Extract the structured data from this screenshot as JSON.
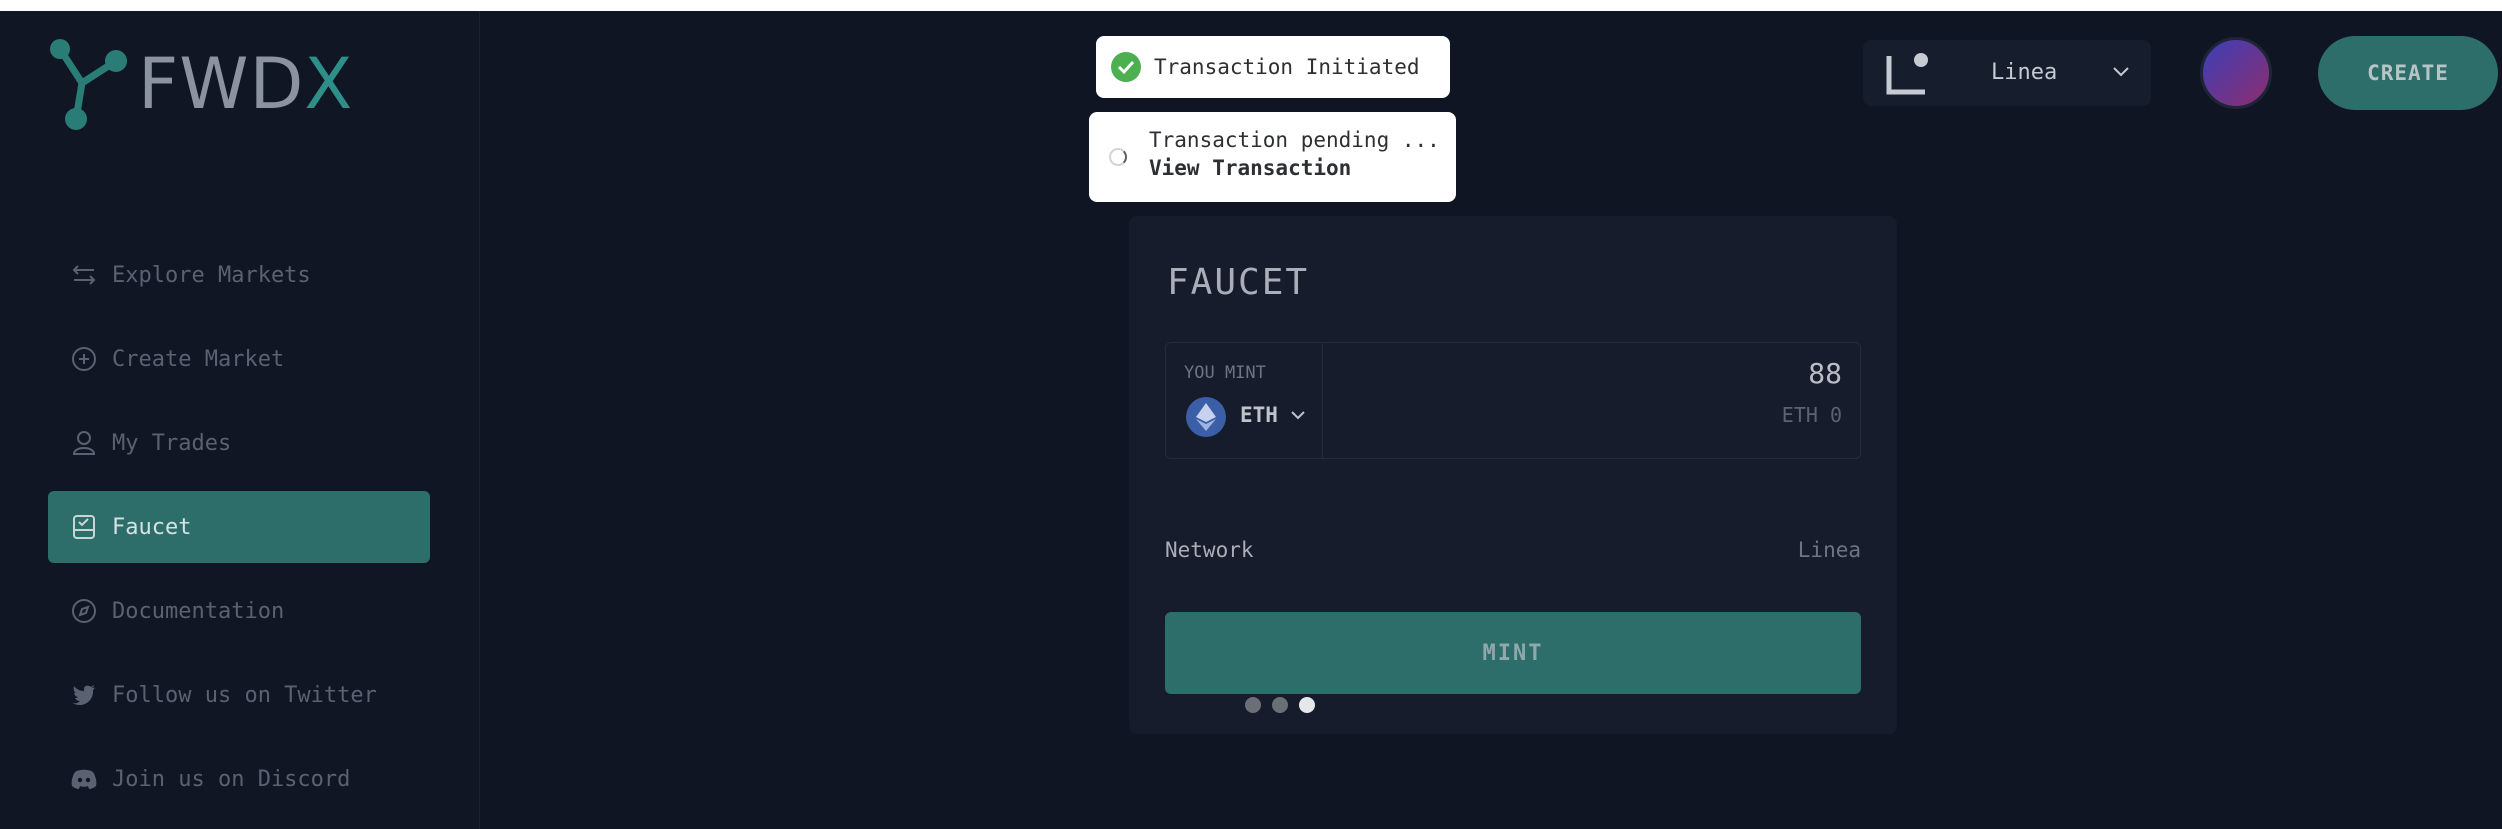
{
  "brand": {
    "name_main": "FWD",
    "name_accent": "X"
  },
  "sidebar": {
    "items": [
      {
        "label": "Explore Markets",
        "icon": "arrows-swap-icon",
        "active": false
      },
      {
        "label": "Create Market",
        "icon": "plus-circle-icon",
        "active": false
      },
      {
        "label": "My Trades",
        "icon": "user-icon",
        "active": false
      },
      {
        "label": "Faucet",
        "icon": "faucet-icon",
        "active": true
      },
      {
        "label": "Documentation",
        "icon": "compass-icon",
        "active": false
      },
      {
        "label": "Follow us on Twitter",
        "icon": "twitter-icon",
        "active": false
      },
      {
        "label": "Join us on Discord",
        "icon": "discord-icon",
        "active": false
      }
    ]
  },
  "header": {
    "network": "Linea",
    "create_label": "CREATE"
  },
  "toasts": {
    "initiated": "Transaction Initiated",
    "pending": "Transaction pending ...",
    "view_link": "View Transaction"
  },
  "faucet": {
    "title": "FAUCET",
    "you_mint_label": "YOU MINT",
    "token": "ETH",
    "amount": "88",
    "balance": "ETH 0",
    "network_label": "Network",
    "network_value": "Linea",
    "mint_label": "MINT"
  },
  "carousel": {
    "count": 3,
    "active_index": 2
  },
  "colors": {
    "accent": "#2d6e6b",
    "background": "#0f1523",
    "card": "#161c2b",
    "success": "#4caf50"
  }
}
